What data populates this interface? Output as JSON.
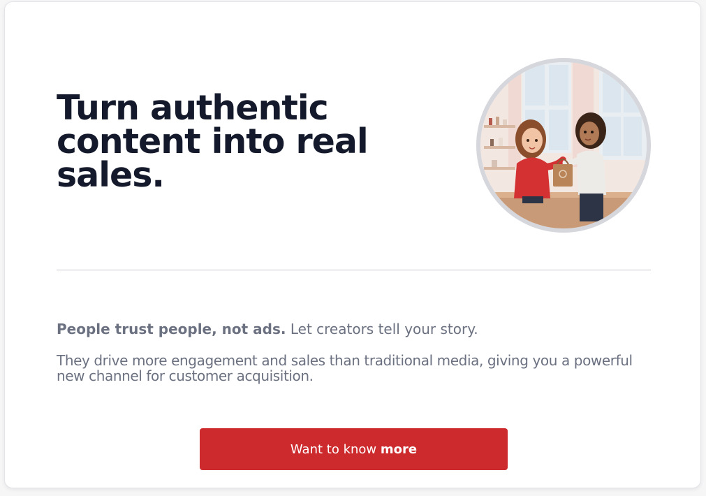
{
  "hero": {
    "headline": "Turn authentic content into real sales.",
    "image_alt": "Two animated women exchanging a shopping bag across a shop counter"
  },
  "intro": {
    "lead_bold": "People trust people, not ads.",
    "lead_rest": " Let creators tell your story.",
    "body": "They drive more engagement and sales than traditional media, giving you a powerful new channel for customer acquisition."
  },
  "cta": {
    "label_regular": "Want to know ",
    "label_bold": "more"
  },
  "colors": {
    "accent": "#cd2a2e",
    "headline": "#141a2b",
    "body_text": "#6b7180",
    "divider": "#c8c9ce"
  }
}
